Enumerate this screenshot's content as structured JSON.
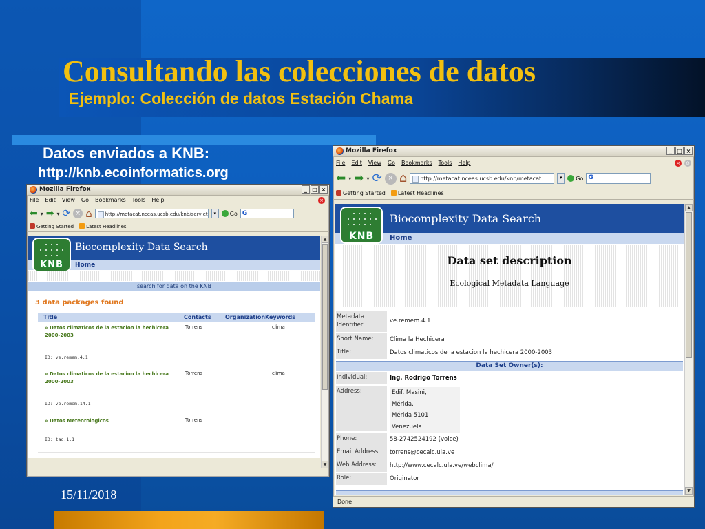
{
  "slide": {
    "title": "Consultando las colecciones de datos",
    "subtitle": "Ejemplo: Colección de datos Estación Chama",
    "caption_line1": "Datos enviados a KNB:",
    "caption_line2": "http://knb.ecoinformatics.org",
    "date": "15/11/2018",
    "colors": {
      "title": "#f2c010",
      "background": "#0d5fbf",
      "accent_bar": "#f3a41b"
    }
  },
  "browser_common": {
    "app_title": "Mozilla Firefox",
    "menu": [
      "File",
      "Edit",
      "View",
      "Go",
      "Bookmarks",
      "Tools",
      "Help"
    ],
    "bookmarks": [
      "Getting Started",
      "Latest Headlines"
    ],
    "go_label": "Go",
    "search_glyph": "G",
    "page_header": "Biocomplexity Data Search",
    "home_label": "Home",
    "logo_text": "KNB"
  },
  "left_window": {
    "url": "http://metacat.nceas.ucsb.edu/knb/servlet/me",
    "search_bar": "search for data on the KNB",
    "found_text": "3 data packages found",
    "columns": [
      "Title",
      "Contacts",
      "Organization",
      "Keywords"
    ],
    "rows": [
      {
        "title": "» Datos climaticos de la estacion la hechicera 2000-2003",
        "contact": "Torrens",
        "keywords": "clima",
        "id": "ID: ve.remem.4.1"
      },
      {
        "title": "» Datos climaticos de la estacion la hechicera 2000-2003",
        "contact": "Torrens",
        "keywords": "clima",
        "id": "ID: ve.remem.14.1"
      },
      {
        "title": "» Datos Meteorologicos",
        "contact": "Torrens",
        "keywords": "",
        "id": "ID: tao.1.1"
      }
    ]
  },
  "right_window": {
    "url": "http://metacat.nceas.ucsb.edu/knb/metacat",
    "heading": "Data set description",
    "subheading": "Ecological Metadata Language",
    "fields": [
      {
        "label": "Metadata Identifier:",
        "value": "ve.remem.4.1"
      },
      {
        "label": "Short Name:",
        "value": "Clima la Hechicera"
      },
      {
        "label": "Title:",
        "value": "Datos climaticos de la estacion la hechicera 2000-2003"
      }
    ],
    "owner_section": "Data Set Owner(s):",
    "individual_label": "Individual:",
    "individual_value": "Ing. Rodrigo Torrens",
    "address_label": "Address:",
    "address_lines": [
      "Edif. Masini,",
      "Mérida,",
      "Mérida 5101",
      "Venezuela"
    ],
    "contact_fields": [
      {
        "label": "Phone:",
        "value": "58-2742524192 (voice)"
      },
      {
        "label": "Email Address:",
        "value": "torrens@cecalc.ula.ve"
      },
      {
        "label": "Web Address:",
        "value": "http://www.cecalc.ula.ve/webclima/"
      },
      {
        "label": "Role:",
        "value": "Originator"
      }
    ],
    "status": "Done"
  }
}
